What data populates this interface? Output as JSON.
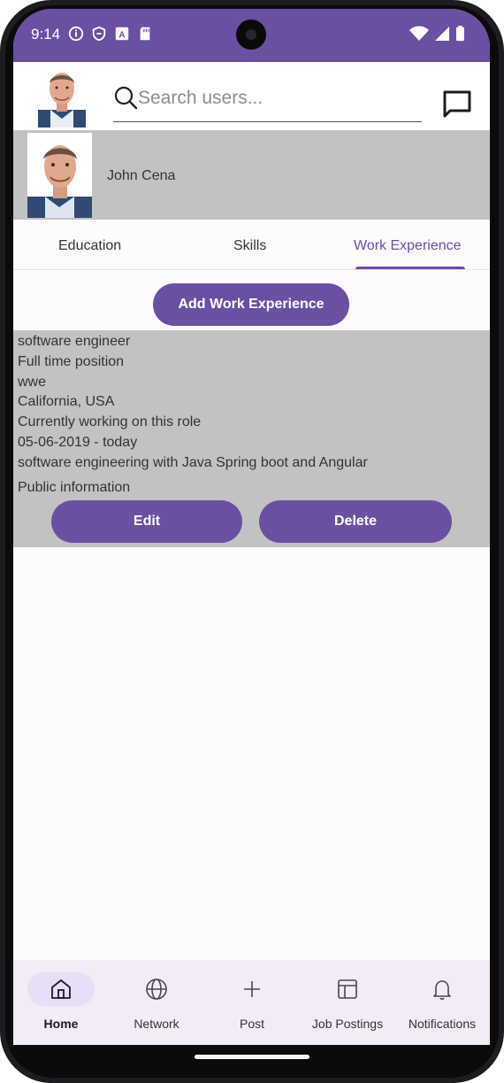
{
  "status_bar": {
    "time": "9:14",
    "left_icons": [
      "info-icon",
      "shield-icon",
      "font-icon",
      "sd-card-icon"
    ],
    "right_icons": [
      "wifi-icon",
      "signal-icon",
      "battery-icon"
    ],
    "background": "#6a4fa3"
  },
  "header": {
    "search_placeholder": "Search users...",
    "search_value": "",
    "avatar_icon": "avatar-photo",
    "chat_icon": "chat-icon"
  },
  "profile": {
    "name": "John Cena"
  },
  "tabs": {
    "items": [
      {
        "label": "Education",
        "active": false
      },
      {
        "label": "Skills",
        "active": false
      },
      {
        "label": "Work Experience",
        "active": true
      }
    ]
  },
  "actions": {
    "add_label": "Add Work Experience"
  },
  "experience": {
    "title": "software engineer",
    "employment_type": "Full time position",
    "company": "wwe",
    "location": "California, USA",
    "status": "Currently working on this role",
    "dates": "05-06-2019 - today",
    "description": "software engineering with Java Spring boot and Angular",
    "visibility": "Public information",
    "edit_label": "Edit",
    "delete_label": "Delete"
  },
  "bottom_nav": {
    "items": [
      {
        "label": "Home",
        "icon": "home-icon",
        "active": true
      },
      {
        "label": "Network",
        "icon": "globe-icon",
        "active": false
      },
      {
        "label": "Post",
        "icon": "plus-icon",
        "active": false
      },
      {
        "label": "Job Postings",
        "icon": "layout-icon",
        "active": false
      },
      {
        "label": "Notifications",
        "icon": "bell-icon",
        "active": false
      }
    ]
  },
  "colors": {
    "accent": "#6a4fa3",
    "card_gray": "#c2c2c2",
    "nav_background": "#f2ecf6",
    "active_pill": "#e8def8"
  }
}
